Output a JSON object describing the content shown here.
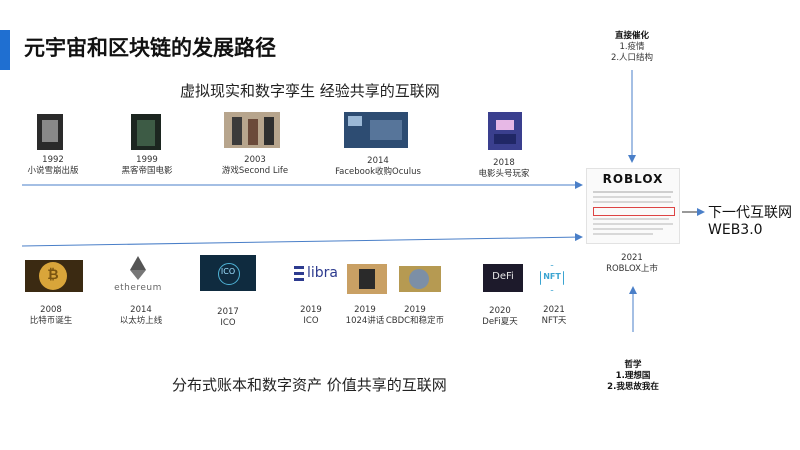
{
  "title": "元宇宙和区块链的发展路径",
  "colors": {
    "accent": "#1f6fd1",
    "arrow": "#4a7fc8"
  },
  "top_track": {
    "subtitle": "虚拟现实和数字孪生  经验共享的互联网",
    "events": [
      {
        "year": "1992",
        "label": "小说雪崩出版"
      },
      {
        "year": "1999",
        "label": "黑客帝国电影"
      },
      {
        "year": "2003",
        "label": "游戏Second  Life"
      },
      {
        "year": "2014",
        "label": "Facebook收购Oculus"
      },
      {
        "year": "2018",
        "label": "电影头号玩家"
      }
    ]
  },
  "bottom_track": {
    "subtitle": "分布式账本和数字资产  价值共享的互联网",
    "events": [
      {
        "year": "2008",
        "label": "比特币诞生"
      },
      {
        "year": "2014",
        "label": "以太坊上线",
        "logo_text": "ethereum"
      },
      {
        "year": "2017",
        "label": "ICO",
        "logo_text": "ICO"
      },
      {
        "year": "2019",
        "label": "ICO",
        "logo_text": "libra"
      },
      {
        "year": "2019",
        "label": "1024讲话"
      },
      {
        "year": "2019",
        "label": "CBDC和稳定币"
      },
      {
        "year": "2020",
        "label": "DeFi夏天",
        "logo_text": "DeFi"
      },
      {
        "year": "2021",
        "label": "NFT天",
        "logo_text": "NFT"
      }
    ]
  },
  "roblox": {
    "logo_text": "ROBLOX",
    "year": "2021",
    "label": "ROBLOX上市"
  },
  "top_note": {
    "heading": "直接催化",
    "lines": [
      "1.疫情",
      "2.人口结构"
    ]
  },
  "bottom_note": {
    "heading": "哲学",
    "lines": [
      "1.理想国",
      "2.我思故我在"
    ]
  },
  "future": {
    "line1": "下一代互联网",
    "line2": "WEB3.0"
  }
}
